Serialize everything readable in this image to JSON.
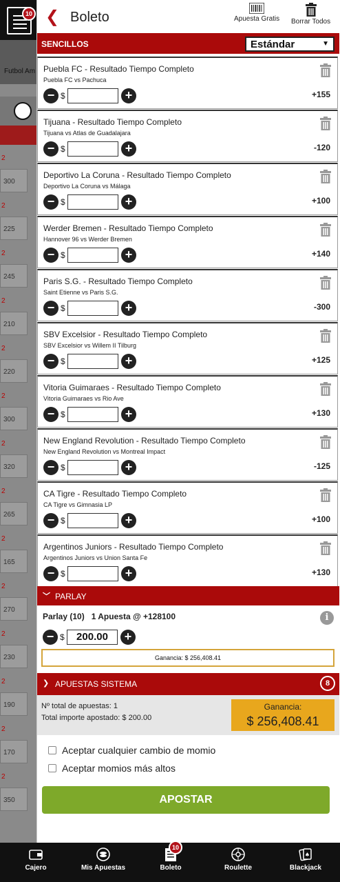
{
  "background": {
    "category_label": "Futbol Am",
    "odds": [
      "300",
      "225",
      "245",
      "210",
      "220",
      "300",
      "320",
      "265",
      "165",
      "270",
      "230",
      "190",
      "170",
      "350"
    ]
  },
  "menu": {
    "badge": "10"
  },
  "header": {
    "title": "Boleto",
    "free_bet_label": "Apuesta Gratis",
    "clear_all_label": "Borrar Todos"
  },
  "sencillos": {
    "label": "SENCILLOS",
    "selected_type": "Estándar"
  },
  "bets": [
    {
      "title": "Puebla FC - Resultado Tiempo Completo",
      "match": "Puebla FC vs Pachuca",
      "odds": "+155",
      "currency": "$",
      "amount": ""
    },
    {
      "title": "Tijuana - Resultado Tiempo Completo",
      "match": "Tijuana vs Atlas de Guadalajara",
      "odds": "-120",
      "currency": "$",
      "amount": ""
    },
    {
      "title": "Deportivo La Coruna - Resultado Tiempo Completo",
      "match": "Deportivo La Coruna vs Málaga",
      "odds": "+100",
      "currency": "$",
      "amount": ""
    },
    {
      "title": "Werder Bremen - Resultado Tiempo Completo",
      "match": "Hannover 96 vs Werder Bremen",
      "odds": "+140",
      "currency": "$",
      "amount": ""
    },
    {
      "title": "Paris S.G. - Resultado Tiempo Completo",
      "match": "Saint Etienne vs Paris S.G.",
      "odds": "-300",
      "currency": "$",
      "amount": ""
    },
    {
      "title": "SBV Excelsior - Resultado Tiempo Completo",
      "match": "SBV Excelsior vs Willem II Tilburg",
      "odds": "+125",
      "currency": "$",
      "amount": ""
    },
    {
      "title": "Vitoria Guimaraes - Resultado Tiempo Completo",
      "match": "Vitoria Guimaraes vs Rio Ave",
      "odds": "+130",
      "currency": "$",
      "amount": ""
    },
    {
      "title": "New England Revolution - Resultado Tiempo Completo",
      "match": "New England Revolution vs Montreal Impact",
      "odds": "-125",
      "currency": "$",
      "amount": ""
    },
    {
      "title": "CA Tigre - Resultado Tiempo Completo",
      "match": "CA Tigre vs Gimnasia LP",
      "odds": "+100",
      "currency": "$",
      "amount": ""
    },
    {
      "title": "Argentinos Juniors - Resultado Tiempo Completo",
      "match": "Argentinos Juniors vs Union Santa Fe",
      "odds": "+130",
      "currency": "$",
      "amount": ""
    }
  ],
  "parlay": {
    "label": "PARLAY",
    "summary": "Parlay (10)   1 Apuesta @ +128100",
    "currency": "$",
    "amount": "200.00",
    "winnings": "Ganancia: $ 256,408.41"
  },
  "sistema": {
    "label": "APUESTAS SISTEMA",
    "count": "8"
  },
  "totals": {
    "total_bets": "Nº total de apuestas: 1",
    "total_amount": "Total importe apostado: $ 200.00",
    "winnings_label": "Ganancia:",
    "winnings_value": "$ 256,408.41"
  },
  "options": {
    "accept_any_change": "Aceptar cualquier cambio de momio",
    "accept_higher": "Aceptar momios más altos"
  },
  "submit_label": "APOSTAR",
  "nav": {
    "items": [
      {
        "label": "Cajero",
        "icon": "wallet-icon"
      },
      {
        "label": "Mis Apuestas",
        "icon": "coins-icon"
      },
      {
        "label": "Boleto",
        "icon": "ticket-icon",
        "badge": "10"
      },
      {
        "label": "Roulette",
        "icon": "roulette-icon"
      },
      {
        "label": "Blackjack",
        "icon": "cards-icon"
      }
    ]
  },
  "colors": {
    "brand_red": "#aa0a0a",
    "submit_green": "#7ea92a",
    "winnings_gold": "#e8a71d"
  }
}
